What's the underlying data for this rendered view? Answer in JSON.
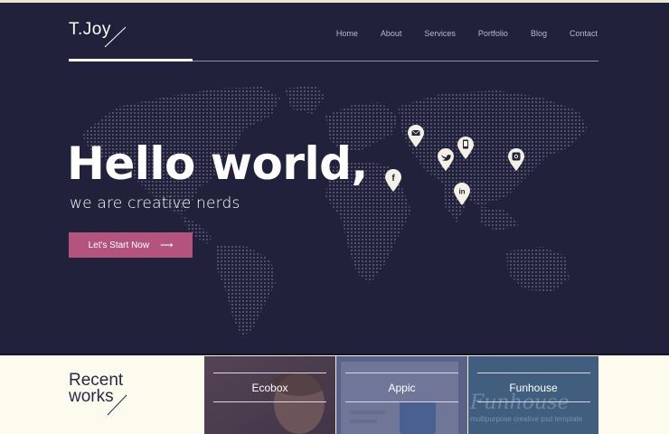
{
  "brand": {
    "logo": "T.Joy"
  },
  "nav": {
    "items": [
      {
        "label": "Home"
      },
      {
        "label": "About"
      },
      {
        "label": "Services"
      },
      {
        "label": "Portfolio"
      },
      {
        "label": "Blog"
      },
      {
        "label": "Contact"
      }
    ],
    "active": "Home"
  },
  "hero": {
    "title": "Hello world,",
    "subtitle": "we are creative nerds",
    "cta_label": "Let's Start Now",
    "cta_arrow": "⟶",
    "pins": [
      {
        "icon": "mail-icon",
        "glyph": "✉"
      },
      {
        "icon": "twitter-icon",
        "glyph": "🐦"
      },
      {
        "icon": "phone-icon",
        "glyph": "▯"
      },
      {
        "icon": "instagram-icon",
        "glyph": "◎"
      },
      {
        "icon": "facebook-icon",
        "glyph": "f"
      },
      {
        "icon": "linkedin-icon",
        "glyph": "in"
      }
    ]
  },
  "recent_works": {
    "title_line1": "Recent",
    "title_line2": "works",
    "items": [
      {
        "label": "Ecobox"
      },
      {
        "label": "Appic"
      },
      {
        "label": "Funhouse",
        "image_text": "Funhouse",
        "image_subtext": "multipurpose creative psd template"
      }
    ]
  },
  "colors": {
    "hero_bg": "#22213b",
    "accent": "#b5537f",
    "light_bg": "#fcfbee"
  }
}
